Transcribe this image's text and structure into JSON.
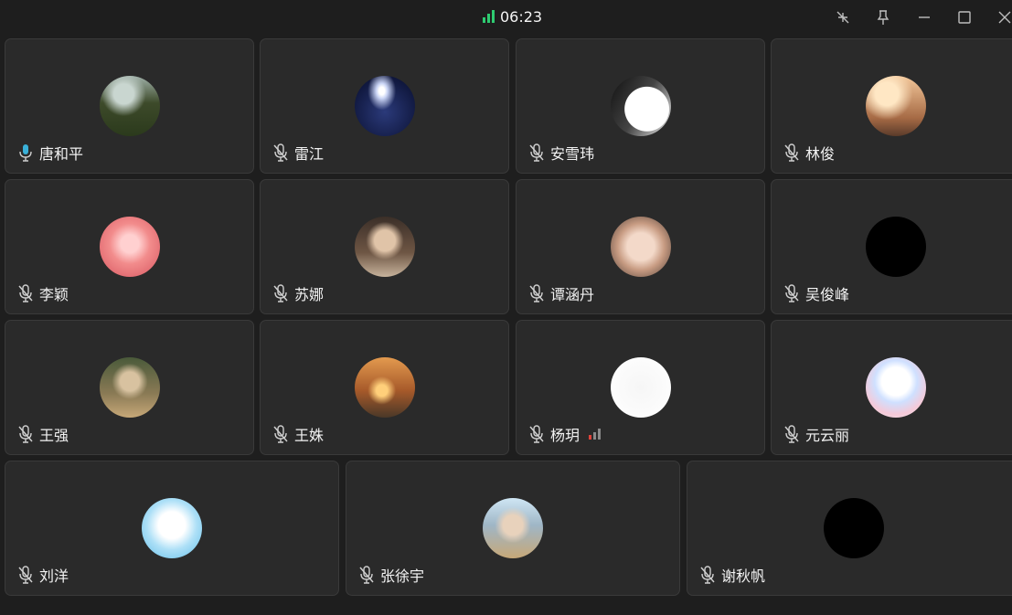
{
  "call": {
    "duration": "06:23"
  },
  "window_controls": [
    "collapse-icon",
    "pin-icon",
    "minimize-icon",
    "maximize-icon",
    "close-icon"
  ],
  "colors": {
    "accent": "#2ecc71",
    "tile_bg": "#2a2a2a",
    "speaking_mic": "#3ab0d8"
  },
  "participants": [
    {
      "name": "唐和平",
      "mic": "speaking"
    },
    {
      "name": "雷江",
      "mic": "muted"
    },
    {
      "name": "安雪玮",
      "mic": "muted"
    },
    {
      "name": "林俊",
      "mic": "muted"
    },
    {
      "name": "李颖",
      "mic": "muted"
    },
    {
      "name": "苏娜",
      "mic": "muted"
    },
    {
      "name": "谭涵丹",
      "mic": "muted"
    },
    {
      "name": "吴俊峰",
      "mic": "muted"
    },
    {
      "name": "王强",
      "mic": "muted"
    },
    {
      "name": "王姝",
      "mic": "muted"
    },
    {
      "name": "杨玥",
      "mic": "muted",
      "weak_signal": true
    },
    {
      "name": "元云丽",
      "mic": "muted"
    },
    {
      "name": "刘洋",
      "mic": "muted"
    },
    {
      "name": "张徐宇",
      "mic": "muted"
    },
    {
      "name": "谢秋帆",
      "mic": "muted"
    }
  ]
}
